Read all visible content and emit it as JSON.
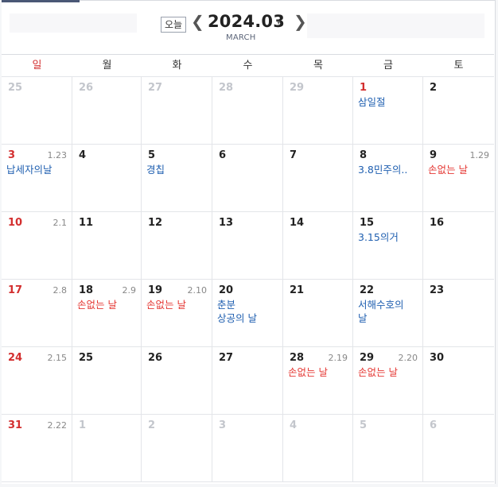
{
  "header": {
    "today_label": "오늘",
    "prev_label": "❮",
    "next_label": "❯",
    "year_month": "2024.03",
    "caret": "▾",
    "month_name": "MARCH"
  },
  "weekdays": [
    "일",
    "월",
    "화",
    "수",
    "목",
    "금",
    "토"
  ],
  "weeks": [
    [
      {
        "d": "25",
        "other": true
      },
      {
        "d": "26",
        "other": true
      },
      {
        "d": "27",
        "other": true
      },
      {
        "d": "28",
        "other": true
      },
      {
        "d": "29",
        "other": true
      },
      {
        "d": "1",
        "holiday": true,
        "events": [
          {
            "text": "삼일절",
            "color": "blue"
          }
        ]
      },
      {
        "d": "2"
      }
    ],
    [
      {
        "d": "3",
        "lunar": "1.23",
        "events": [
          {
            "text": "납세자의날",
            "color": "blue"
          }
        ]
      },
      {
        "d": "4"
      },
      {
        "d": "5",
        "events": [
          {
            "text": "경칩",
            "color": "blue"
          }
        ]
      },
      {
        "d": "6"
      },
      {
        "d": "7"
      },
      {
        "d": "8",
        "events": [
          {
            "text": "3.8민주의..",
            "color": "blue"
          }
        ]
      },
      {
        "d": "9",
        "lunar": "1.29",
        "events": [
          {
            "text": "손없는 날",
            "color": "red"
          }
        ]
      }
    ],
    [
      {
        "d": "10",
        "lunar": "2.1"
      },
      {
        "d": "11"
      },
      {
        "d": "12"
      },
      {
        "d": "13"
      },
      {
        "d": "14"
      },
      {
        "d": "15",
        "events": [
          {
            "text": "3.15의거",
            "color": "blue"
          }
        ]
      },
      {
        "d": "16"
      }
    ],
    [
      {
        "d": "17",
        "lunar": "2.8"
      },
      {
        "d": "18",
        "lunar": "2.9",
        "events": [
          {
            "text": "손없는 날",
            "color": "red"
          }
        ]
      },
      {
        "d": "19",
        "lunar": "2.10",
        "events": [
          {
            "text": "손없는 날",
            "color": "red"
          }
        ]
      },
      {
        "d": "20",
        "events": [
          {
            "text": "춘분",
            "color": "blue"
          },
          {
            "text": "상공의 날",
            "color": "blue"
          }
        ]
      },
      {
        "d": "21"
      },
      {
        "d": "22",
        "events": [
          {
            "text": "서해수호의",
            "color": "blue"
          },
          {
            "text": "날",
            "color": "blue"
          }
        ]
      },
      {
        "d": "23"
      }
    ],
    [
      {
        "d": "24",
        "lunar": "2.15"
      },
      {
        "d": "25"
      },
      {
        "d": "26"
      },
      {
        "d": "27"
      },
      {
        "d": "28",
        "lunar": "2.19",
        "events": [
          {
            "text": "손없는 날",
            "color": "red"
          }
        ]
      },
      {
        "d": "29",
        "lunar": "2.20",
        "events": [
          {
            "text": "손없는 날",
            "color": "red"
          }
        ]
      },
      {
        "d": "30"
      }
    ],
    [
      {
        "d": "31",
        "lunar": "2.22"
      },
      {
        "d": "1",
        "other": true
      },
      {
        "d": "2",
        "other": true
      },
      {
        "d": "3",
        "other": true
      },
      {
        "d": "4",
        "other": true
      },
      {
        "d": "5",
        "other": true
      },
      {
        "d": "6",
        "other": true
      }
    ]
  ]
}
